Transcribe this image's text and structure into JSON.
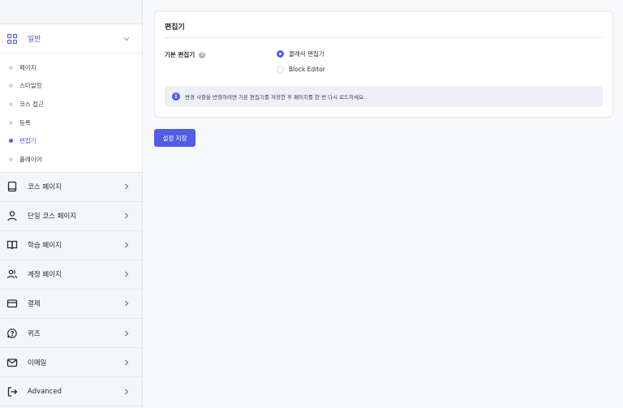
{
  "sidebar": {
    "group": {
      "label": "일반",
      "icon": "grid-icon",
      "expanded": true
    },
    "sub_items": [
      {
        "label": "페이지",
        "active": false
      },
      {
        "label": "스타일링",
        "active": false
      },
      {
        "label": "코스 접근",
        "active": false
      },
      {
        "label": "등록",
        "active": false
      },
      {
        "label": "편집기",
        "active": true
      },
      {
        "label": "플레이어",
        "active": false
      }
    ],
    "items": [
      {
        "label": "코스 페이지",
        "icon": "book-icon"
      },
      {
        "label": "단일 코스 페이지",
        "icon": "user-icon"
      },
      {
        "label": "학습 페이지",
        "icon": "open-book-icon"
      },
      {
        "label": "계정 페이지",
        "icon": "users-icon"
      },
      {
        "label": "결제",
        "icon": "credit-card-icon"
      },
      {
        "label": "퀴즈",
        "icon": "chat-question-icon"
      },
      {
        "label": "이메일",
        "icon": "mail-icon"
      },
      {
        "label": "Advanced",
        "icon": "sign-out-icon"
      }
    ]
  },
  "main": {
    "section_title": "편집기",
    "field_label": "기본 편집기",
    "options": [
      {
        "label": "클래식 편집기",
        "checked": true
      },
      {
        "label": "Block Editor",
        "checked": false
      }
    ],
    "notice": "변경 사항을 반영하려면 기본 편집기를 저장한 후 페이지를 한 번 다시 로드하세요.",
    "save_label": "설정 저장"
  },
  "colors": {
    "accent": "#4f5de8",
    "sidebar_bg": "#f5f6f8",
    "notice_bg": "#edf0f6"
  }
}
